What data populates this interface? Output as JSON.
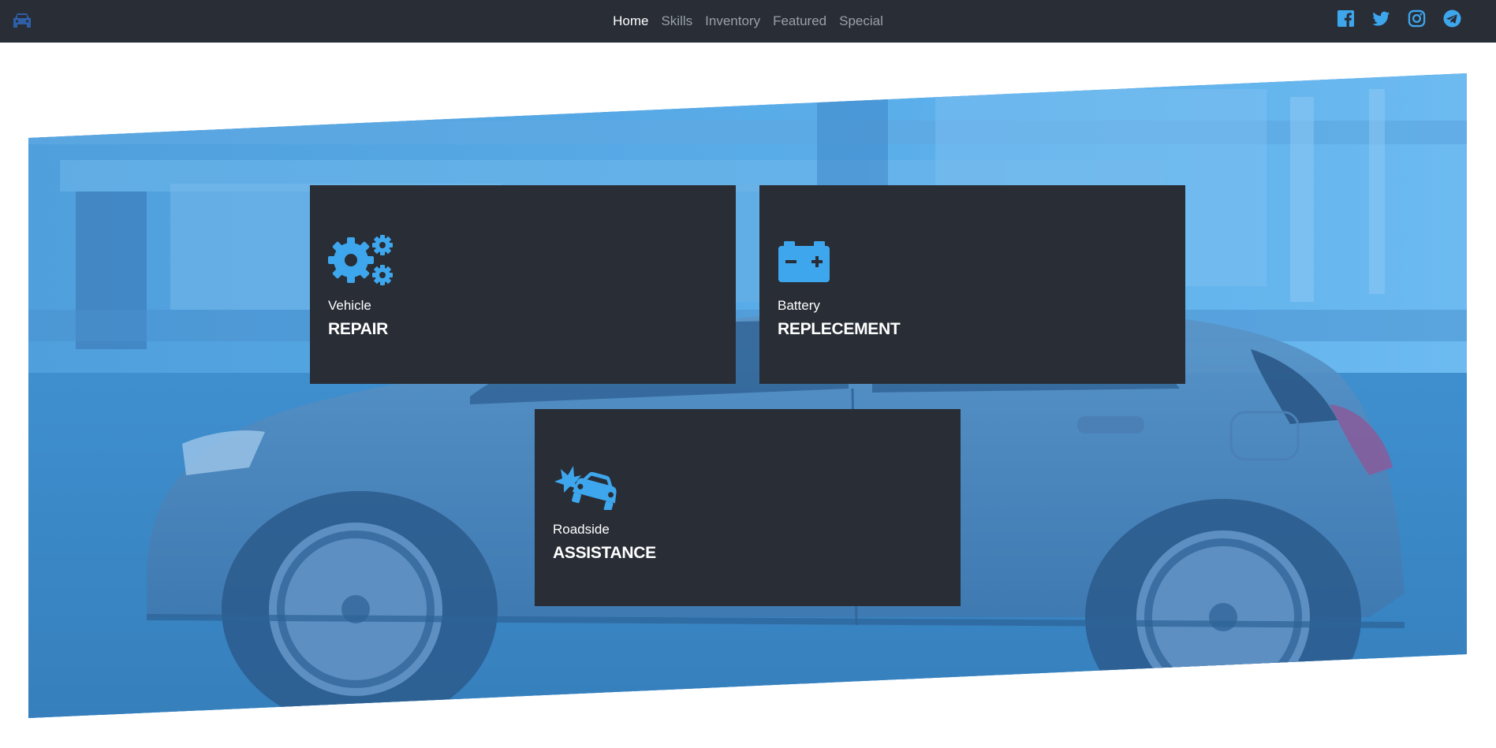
{
  "nav": {
    "brand_icon": "car-icon",
    "links": [
      {
        "label": "Home",
        "active": true
      },
      {
        "label": "Skills",
        "active": false
      },
      {
        "label": "Inventory",
        "active": false
      },
      {
        "label": "Featured",
        "active": false
      },
      {
        "label": "Special",
        "active": false
      }
    ],
    "socials": [
      "facebook-icon",
      "twitter-icon",
      "instagram-icon",
      "telegram-icon"
    ]
  },
  "hero": {
    "background": "car-photo-blue-tint"
  },
  "services": [
    {
      "icon": "gears-icon",
      "subtitle": "Vehicle",
      "title": "REPAIR"
    },
    {
      "icon": "battery-icon",
      "subtitle": "Battery",
      "title": "REPLECEMENT"
    },
    {
      "icon": "car-crash-icon",
      "subtitle": "Roadside",
      "title": "ASSISTANCE"
    }
  ],
  "colors": {
    "navbar_bg": "#282d36",
    "accent": "#3ea6ec",
    "hero_tint": "#3f8fcf",
    "card_bg": "#282d36",
    "nav_active": "#ffffff",
    "nav_inactive": "#9aa0a8"
  }
}
